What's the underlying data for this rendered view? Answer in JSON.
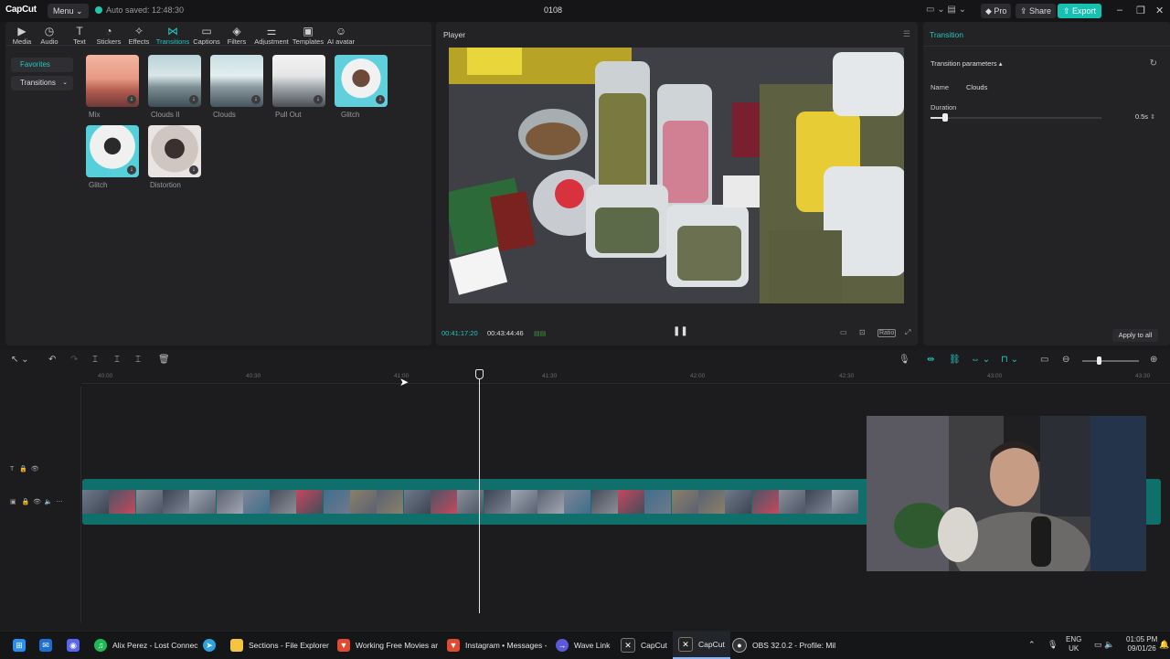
{
  "app": {
    "logo": "CapCut",
    "menu_label": "Menu",
    "autosave": "Auto saved: 12:48:30",
    "project_title": "0108",
    "pro_label": "Pro",
    "share_label": "Share",
    "export_label": "Export",
    "accent_color": "#22c7c0"
  },
  "toolbar": [
    {
      "label": "Media",
      "icon": "media-icon"
    },
    {
      "label": "Audio",
      "icon": "audio-icon"
    },
    {
      "label": "Text",
      "icon": "text-icon"
    },
    {
      "label": "Stickers",
      "icon": "stickers-icon"
    },
    {
      "label": "Effects",
      "icon": "effects-icon"
    },
    {
      "label": "Transitions",
      "icon": "transitions-icon",
      "active": true
    },
    {
      "label": "Captions",
      "icon": "captions-icon"
    },
    {
      "label": "Filters",
      "icon": "filters-icon"
    },
    {
      "label": "Adjustment",
      "icon": "adjustment-icon"
    },
    {
      "label": "Templates",
      "icon": "templates-icon"
    },
    {
      "label": "AI avatar",
      "icon": "ai-avatar-icon"
    }
  ],
  "sidebar": {
    "favorites": "Favorites",
    "transitions": "Transitions"
  },
  "transitions": [
    {
      "label": "Mix"
    },
    {
      "label": "Clouds II"
    },
    {
      "label": "Clouds"
    },
    {
      "label": "Pull Out"
    },
    {
      "label": "Glitch"
    },
    {
      "label": "Glitch"
    },
    {
      "label": "Distortion"
    }
  ],
  "player": {
    "title": "Player",
    "current_time": "00:41:17:20",
    "total_time": "00:43:44:46",
    "ratio_label": "Ratio"
  },
  "inspector": {
    "title": "Transition",
    "params_label": "Transition parameters",
    "name_label": "Name",
    "name_value": "Clouds",
    "duration_label": "Duration",
    "duration_value": "0.5s",
    "duration_fraction": 0.09,
    "apply_all": "Apply to all"
  },
  "timeline": {
    "ruler": [
      "40:00",
      "40:30",
      "41:00",
      "41:30",
      "42:00",
      "42:30",
      "43:00",
      "43:30"
    ],
    "zoom_fraction": 0.3
  },
  "taskbar": {
    "items": [
      {
        "label": "Alix Perez - Lost Connec",
        "icon": "spotify-icon",
        "color": "#1db954"
      },
      {
        "label": "",
        "icon": "telegram-icon",
        "color": "#2aa3de"
      },
      {
        "label": "Sections - File Explorer",
        "icon": "folder-icon",
        "color": "#f5c542"
      },
      {
        "label": "Working Free Movies ar",
        "icon": "brave-icon",
        "color": "#e04a2f"
      },
      {
        "label": "Instagram • Messages -",
        "icon": "brave-icon",
        "color": "#e04a2f"
      },
      {
        "label": "Wave Link",
        "icon": "wave-link-icon",
        "color": "#5a5ad8"
      },
      {
        "label": "CapCut",
        "icon": "capcut-icon",
        "color": "#222"
      },
      {
        "label": "CapCut",
        "icon": "capcut-icon",
        "color": "#222",
        "active": true
      },
      {
        "label": "OBS 32.0.2 - Profile: Mil",
        "icon": "obs-icon",
        "color": "#333"
      }
    ],
    "lang": "ENG",
    "region": "UK",
    "time": "01:05 PM",
    "date": "09/01/26"
  }
}
